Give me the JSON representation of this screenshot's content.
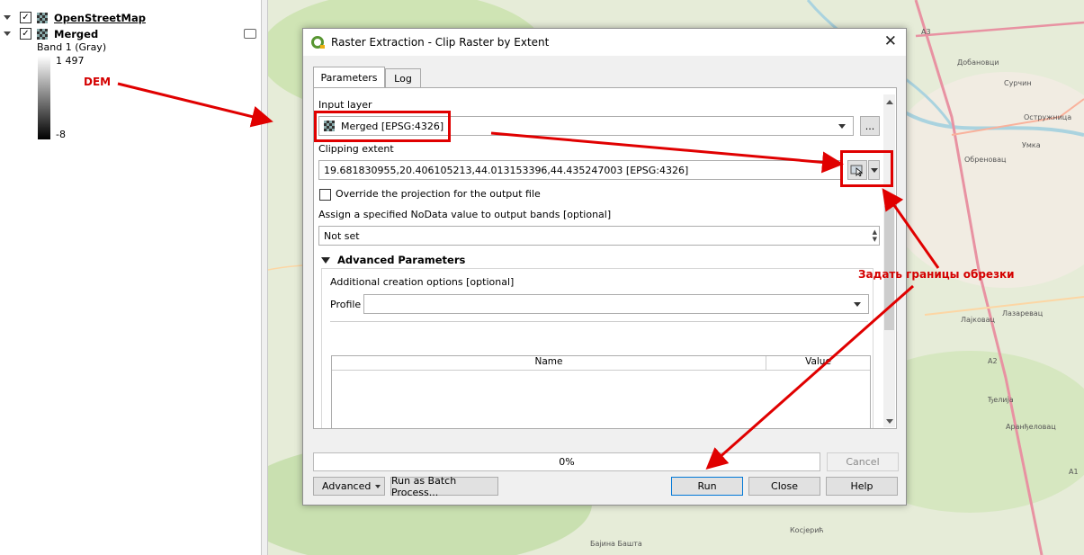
{
  "layers": [
    {
      "name": "OpenStreetMap",
      "checked": "✓"
    },
    {
      "name": "Merged",
      "checked": "✓"
    }
  ],
  "legend": {
    "band": "Band 1 (Gray)",
    "max": "1 497",
    "min": "-8"
  },
  "map": {
    "labels": [
      "Добановци",
      "Сурчин",
      "Остружница",
      "Умка",
      "Обреновац",
      "Лазаревац",
      "Аранђеловац",
      "Бајина Башта",
      "Косјерић",
      "A2",
      "A3",
      "A1",
      "Ђелија",
      "Лајковац"
    ]
  },
  "annotations": {
    "dem": "DEM",
    "set_extent": "Задать границы обрезки"
  },
  "dialog": {
    "title": "Raster Extraction - Clip Raster by Extent",
    "tabs": [
      "Parameters",
      "Log"
    ],
    "input_layer_label": "Input layer",
    "input_layer_value": "Merged [EPSG:4326]",
    "browse_button": "...",
    "clipping_extent_label": "Clipping extent",
    "clipping_extent_value": "19.681830955,20.406105213,44.013153396,44.435247003 [EPSG:4326]",
    "override_label": "Override the projection for the output file",
    "nodata_label": "Assign a specified NoData value to output bands [optional]",
    "nodata_value": "Not set",
    "advanced_params_label": "Advanced Parameters",
    "creation_options_label": "Additional creation options [optional]",
    "profile_label": "Profile",
    "profile_value": "",
    "table_headers": [
      "Name",
      "Value"
    ],
    "progress_text": "0%",
    "progress": 0,
    "buttons": {
      "cancel": "Cancel",
      "advanced": "Advanced",
      "batch": "Run as Batch Process...",
      "run": "Run",
      "close": "Close",
      "help": "Help"
    }
  },
  "colors": {
    "annotation_red": "#e00000",
    "qgis_green": "#589632",
    "map_bg": "#e9efdc"
  }
}
